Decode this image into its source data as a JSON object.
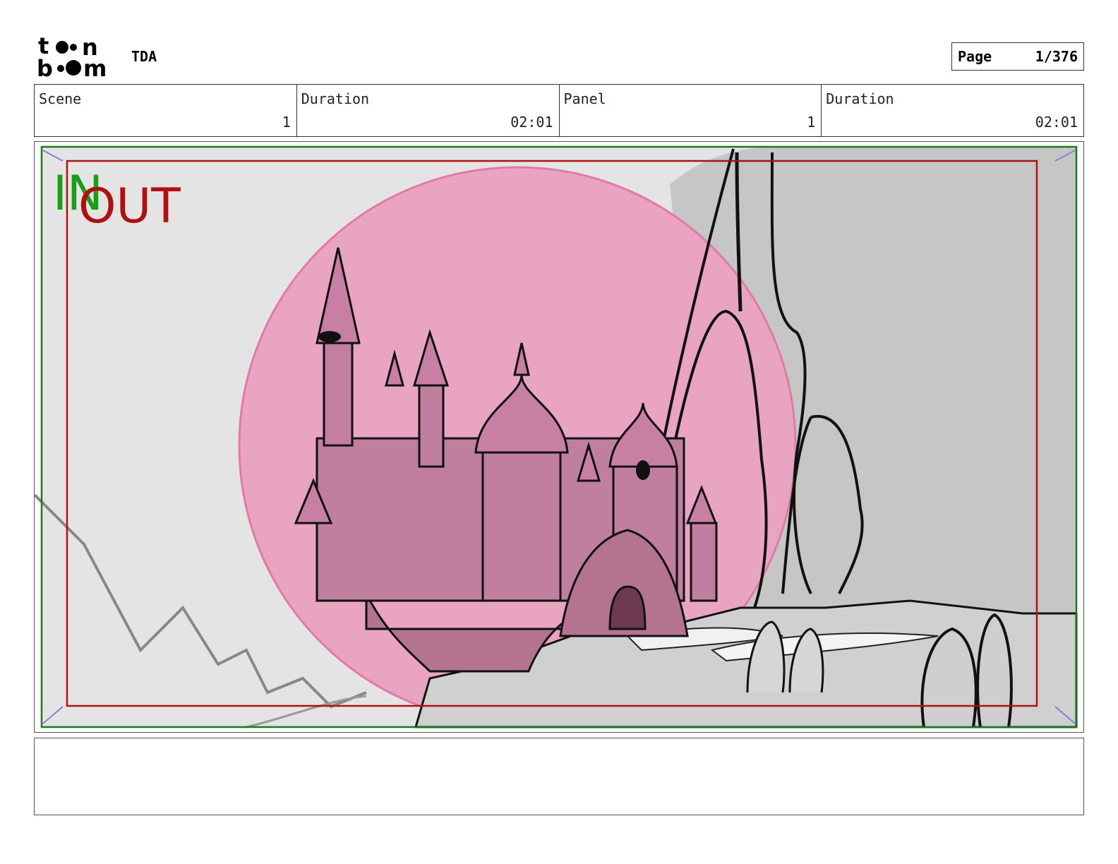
{
  "header": {
    "logo_text": "toon boom",
    "project": "TDA",
    "page_label": "Page",
    "page_value": "1/376"
  },
  "info": {
    "scene_label": "Scene",
    "scene_value": "1",
    "scene_duration_label": "Duration",
    "scene_duration_value": "02:01",
    "panel_label": "Panel",
    "panel_value": "1",
    "panel_duration_label": "Duration",
    "panel_duration_value": "02:01"
  },
  "panel_image": {
    "in_label": "IN",
    "out_label": "OUT",
    "in_color": "#1a9e1a",
    "out_color": "#b01010",
    "circle_color": "#e8a4c0"
  },
  "notes": {
    "text": ""
  }
}
